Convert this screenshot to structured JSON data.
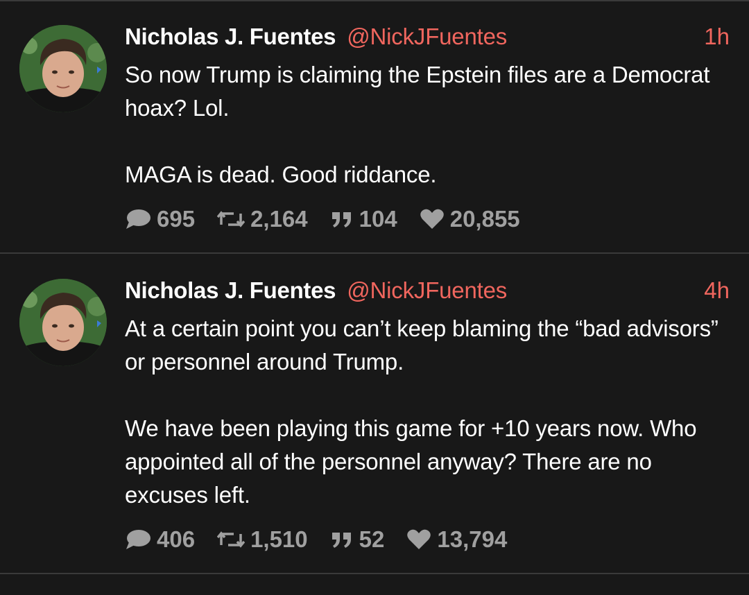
{
  "colors": {
    "background": "#181818",
    "divider": "#3a3a3a",
    "accent": "#f0665e",
    "text": "#ffffff",
    "muted": "#a0a0a0"
  },
  "posts": [
    {
      "display_name": "Nicholas J. Fuentes",
      "handle": "@NickJFuentes",
      "time": "1h",
      "paragraphs": [
        "So now Trump is claiming the Epstein files are a Democrat hoax? Lol.",
        "MAGA is dead. Good riddance."
      ],
      "stats": {
        "replies": "695",
        "reposts": "2,164",
        "quotes": "104",
        "likes": "20,855"
      }
    },
    {
      "display_name": "Nicholas J. Fuentes",
      "handle": "@NickJFuentes",
      "time": "4h",
      "paragraphs": [
        "At a certain point you can’t keep blaming the “bad advisors” or personnel around Trump.",
        "We have been playing this game for +10 years now. Who appointed all of the personnel anyway? There are no excuses left."
      ],
      "stats": {
        "replies": "406",
        "reposts": "1,510",
        "quotes": "52",
        "likes": "13,794"
      }
    }
  ],
  "icons": {
    "reply": "speech-bubble-icon",
    "repost": "repost-arrows-icon",
    "quote": "quote-marks-icon",
    "like": "heart-icon"
  }
}
